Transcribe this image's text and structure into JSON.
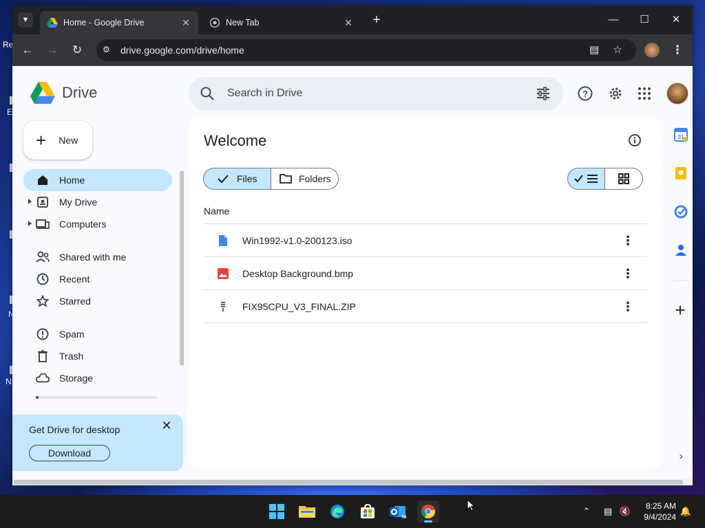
{
  "desktop": {
    "labels": [
      "Re",
      "E",
      "N",
      "N"
    ]
  },
  "browser": {
    "tabs": [
      {
        "title": "Home - Google Drive",
        "active": true,
        "icon": "google-drive-icon"
      },
      {
        "title": "New Tab",
        "active": false,
        "icon": "chrome-icon"
      }
    ],
    "url": "drive.google.com/drive/home"
  },
  "drive": {
    "app_name": "Drive",
    "search_placeholder": "Search in Drive",
    "new_label": "New",
    "nav": [
      {
        "label": "Home",
        "icon": "home-icon",
        "active": true,
        "expandable": false
      },
      {
        "label": "My Drive",
        "icon": "my-drive-icon",
        "active": false,
        "expandable": true
      },
      {
        "label": "Computers",
        "icon": "computers-icon",
        "active": false,
        "expandable": true
      },
      {
        "label": "Shared with me",
        "icon": "shared-icon",
        "active": false,
        "expandable": false
      },
      {
        "label": "Recent",
        "icon": "clock-icon",
        "active": false,
        "expandable": false
      },
      {
        "label": "Starred",
        "icon": "star-icon",
        "active": false,
        "expandable": false
      },
      {
        "label": "Spam",
        "icon": "spam-icon",
        "active": false,
        "expandable": false
      },
      {
        "label": "Trash",
        "icon": "trash-icon",
        "active": false,
        "expandable": false
      },
      {
        "label": "Storage",
        "icon": "cloud-icon",
        "active": false,
        "expandable": false
      }
    ],
    "storage_used_fraction": 0.02,
    "promo": {
      "title": "Get Drive for desktop",
      "button": "Download"
    },
    "main": {
      "title": "Welcome",
      "chips": [
        {
          "label": "Files",
          "selected": true
        },
        {
          "label": "Folders",
          "selected": false
        }
      ],
      "view_mode": "list",
      "column_header": "Name",
      "files": [
        {
          "name": "Win1992-v1.0-200123.iso",
          "type": "doc",
          "icon_color": "#4285f4"
        },
        {
          "name": "Desktop Background.bmp",
          "type": "image",
          "icon_color": "#ea4335"
        },
        {
          "name": "FIX95CPU_V3_FINAL.ZIP",
          "type": "zip",
          "icon_color": "#5f6368"
        }
      ]
    }
  },
  "taskbar": {
    "time": "8:25 AM",
    "date": "9/4/2024",
    "apps": [
      "windows-start-icon",
      "file-explorer-icon",
      "edge-icon",
      "microsoft-store-icon",
      "outlook-icon",
      "chrome-icon"
    ]
  }
}
